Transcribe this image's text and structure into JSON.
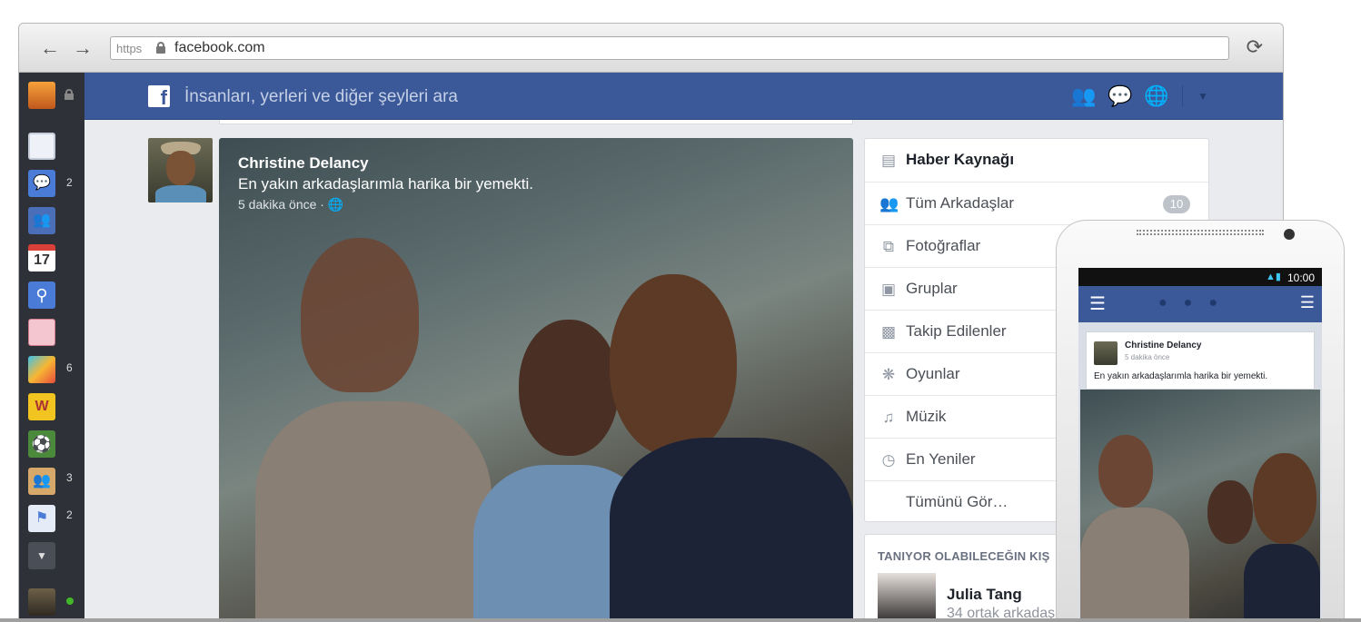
{
  "browser": {
    "scheme": "https",
    "url": "facebook.com",
    "back_icon": "arrow-left-icon",
    "forward_icon": "arrow-right-icon",
    "reload_icon": "reload-icon"
  },
  "sidebar": {
    "badges": [
      {
        "item": "messages",
        "count": "2"
      },
      {
        "item": "game",
        "count": "6"
      },
      {
        "item": "groups",
        "count": "3"
      },
      {
        "item": "pages",
        "count": "2"
      }
    ],
    "calendar_day": "17"
  },
  "facebook_bar": {
    "search_placeholder": "İnsanları, yerleri ve diğer şeyleri ara",
    "brand_color": "#3b5998"
  },
  "post": {
    "author": "Christine Delancy",
    "text": "En yakın arkadaşlarımla harika bir yemekti.",
    "time": "5 dakika önce ·"
  },
  "menu": {
    "items": [
      {
        "label": "Haber Kaynağı",
        "icon": "news-feed-icon",
        "bold": true
      },
      {
        "label": "Tüm Arkadaşlar",
        "icon": "friends-icon",
        "badge": "10"
      },
      {
        "label": "Fotoğraflar",
        "icon": "photos-icon"
      },
      {
        "label": "Gruplar",
        "icon": "groups-icon"
      },
      {
        "label": "Takip Edilenler",
        "icon": "following-icon"
      },
      {
        "label": "Oyunlar",
        "icon": "games-icon"
      },
      {
        "label": "Müzik",
        "icon": "music-icon"
      },
      {
        "label": "En Yeniler",
        "icon": "clock-icon"
      },
      {
        "label": "Tümünü Gör…",
        "icon": ""
      }
    ]
  },
  "pymk": {
    "title": "TANIYOR OLABILECEĞIN KIŞ",
    "name": "Julia Tang",
    "mutual": "34 ortak arkadaş"
  },
  "phone": {
    "time": "10:00",
    "post_author": "Christine Delancy",
    "post_time": "5 dakika önce",
    "post_text": "En yakın arkadaşlarımla harika bir yemekti."
  }
}
